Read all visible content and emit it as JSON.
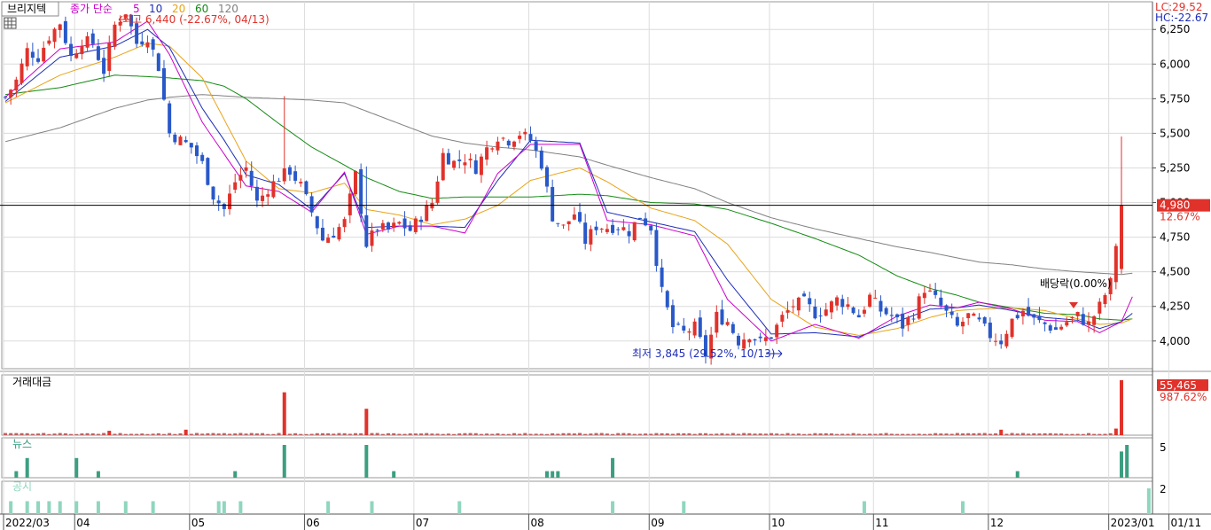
{
  "stock": {
    "name": "브리지텍",
    "legend_title": "종가 단순",
    "ma_labels": [
      "5",
      "10",
      "20",
      "60",
      "120"
    ],
    "ma_colors": [
      "#cc00cc",
      "#1d2db8",
      "#e8a317",
      "#138a13",
      "#808080"
    ]
  },
  "top_right": {
    "lc": "LC:29.52",
    "hc": "HC:-22.67"
  },
  "annotations": {
    "high": "최고 6,440 (-22.67%, 04/13)",
    "low": "최저 3,845 (29.52%, 10/13)",
    "dividend": "배당락(0.00%)"
  },
  "last_price": {
    "label": "4,980",
    "change": "12.67%",
    "value": 4980
  },
  "panels": {
    "amount": {
      "title": "거래대금",
      "last_label": "55,465",
      "last_change": "987.62%"
    },
    "news": {
      "title": "뉴스",
      "axis_label": "5"
    },
    "disclosure": {
      "title": "공시",
      "axis_label": "2"
    }
  },
  "chart_data": {
    "type": "candlestick",
    "ylim": [
      3800,
      6450
    ],
    "y_ticks": [
      4000,
      4250,
      4500,
      4750,
      5000,
      5250,
      5500,
      5750,
      6000,
      6250
    ],
    "y_tick_labels": [
      "4,000",
      "4,250",
      "4,500",
      "4,750",
      "5,000",
      "5,250",
      "5,500",
      "5,750",
      "6,000",
      "6,250"
    ],
    "x_tick_labels": [
      "2022/03",
      "04",
      "05",
      "06",
      "07",
      "08",
      "09",
      "10",
      "11",
      "12",
      "2023/01",
      "01/11"
    ],
    "x_tick_trading_days": [
      0,
      13,
      34,
      55,
      75,
      96,
      118,
      140,
      159,
      180,
      202,
      213
    ],
    "ma_series": [
      {
        "name": "5",
        "values": [
          [
            0,
            5760
          ],
          [
            10,
            6110
          ],
          [
            20,
            6160
          ],
          [
            26,
            6310
          ],
          [
            30,
            6070
          ],
          [
            36,
            5580
          ],
          [
            40,
            5350
          ],
          [
            44,
            5120
          ],
          [
            50,
            5080
          ],
          [
            56,
            4930
          ],
          [
            62,
            5220
          ],
          [
            66,
            4770
          ],
          [
            72,
            4830
          ],
          [
            78,
            4830
          ],
          [
            84,
            4780
          ],
          [
            90,
            5210
          ],
          [
            96,
            5420
          ],
          [
            105,
            5420
          ],
          [
            110,
            4870
          ],
          [
            118,
            4840
          ],
          [
            126,
            4760
          ],
          [
            132,
            4300
          ],
          [
            140,
            4000
          ],
          [
            148,
            4120
          ],
          [
            156,
            4020
          ],
          [
            163,
            4180
          ],
          [
            169,
            4260
          ],
          [
            174,
            4240
          ],
          [
            178,
            4280
          ],
          [
            184,
            4230
          ],
          [
            190,
            4150
          ],
          [
            196,
            4140
          ],
          [
            200,
            4060
          ],
          [
            204,
            4140
          ],
          [
            206,
            4320
          ]
        ]
      },
      {
        "name": "10",
        "values": [
          [
            0,
            5730
          ],
          [
            10,
            6050
          ],
          [
            20,
            6130
          ],
          [
            26,
            6250
          ],
          [
            30,
            6120
          ],
          [
            36,
            5680
          ],
          [
            40,
            5450
          ],
          [
            44,
            5200
          ],
          [
            50,
            5130
          ],
          [
            56,
            4950
          ],
          [
            62,
            5210
          ],
          [
            66,
            4820
          ],
          [
            72,
            4830
          ],
          [
            78,
            4830
          ],
          [
            84,
            4820
          ],
          [
            90,
            5160
          ],
          [
            96,
            5450
          ],
          [
            105,
            5430
          ],
          [
            110,
            4930
          ],
          [
            118,
            4860
          ],
          [
            126,
            4790
          ],
          [
            132,
            4440
          ],
          [
            140,
            4050
          ],
          [
            148,
            4060
          ],
          [
            156,
            4030
          ],
          [
            163,
            4140
          ],
          [
            169,
            4230
          ],
          [
            174,
            4240
          ],
          [
            178,
            4260
          ],
          [
            184,
            4220
          ],
          [
            190,
            4170
          ],
          [
            196,
            4150
          ],
          [
            200,
            4090
          ],
          [
            204,
            4140
          ],
          [
            206,
            4200
          ]
        ]
      },
      {
        "name": "20",
        "values": [
          [
            0,
            5720
          ],
          [
            10,
            5920
          ],
          [
            20,
            6050
          ],
          [
            26,
            6150
          ],
          [
            30,
            6130
          ],
          [
            36,
            5900
          ],
          [
            40,
            5600
          ],
          [
            44,
            5300
          ],
          [
            50,
            5100
          ],
          [
            56,
            5070
          ],
          [
            62,
            5140
          ],
          [
            66,
            4950
          ],
          [
            72,
            4910
          ],
          [
            78,
            4840
          ],
          [
            84,
            4880
          ],
          [
            90,
            4980
          ],
          [
            96,
            5160
          ],
          [
            105,
            5250
          ],
          [
            110,
            5150
          ],
          [
            118,
            4960
          ],
          [
            126,
            4870
          ],
          [
            132,
            4700
          ],
          [
            140,
            4300
          ],
          [
            148,
            4100
          ],
          [
            156,
            4040
          ],
          [
            163,
            4090
          ],
          [
            169,
            4170
          ],
          [
            174,
            4220
          ],
          [
            178,
            4230
          ],
          [
            184,
            4240
          ],
          [
            190,
            4220
          ],
          [
            196,
            4160
          ],
          [
            200,
            4120
          ],
          [
            204,
            4130
          ],
          [
            206,
            4160
          ]
        ]
      },
      {
        "name": "60",
        "values": [
          [
            0,
            5780
          ],
          [
            10,
            5830
          ],
          [
            20,
            5920
          ],
          [
            26,
            5910
          ],
          [
            30,
            5900
          ],
          [
            36,
            5880
          ],
          [
            40,
            5840
          ],
          [
            44,
            5750
          ],
          [
            50,
            5570
          ],
          [
            56,
            5400
          ],
          [
            62,
            5270
          ],
          [
            66,
            5180
          ],
          [
            72,
            5080
          ],
          [
            78,
            5030
          ],
          [
            84,
            5040
          ],
          [
            90,
            5040
          ],
          [
            96,
            5040
          ],
          [
            105,
            5060
          ],
          [
            110,
            5050
          ],
          [
            118,
            5000
          ],
          [
            126,
            4990
          ],
          [
            132,
            4950
          ],
          [
            140,
            4850
          ],
          [
            148,
            4740
          ],
          [
            156,
            4620
          ],
          [
            163,
            4470
          ],
          [
            169,
            4380
          ],
          [
            174,
            4330
          ],
          [
            178,
            4280
          ],
          [
            184,
            4240
          ],
          [
            190,
            4200
          ],
          [
            196,
            4190
          ],
          [
            200,
            4160
          ],
          [
            204,
            4150
          ],
          [
            206,
            4160
          ]
        ]
      },
      {
        "name": "120",
        "values": [
          [
            0,
            5440
          ],
          [
            10,
            5540
          ],
          [
            20,
            5680
          ],
          [
            26,
            5740
          ],
          [
            30,
            5760
          ],
          [
            36,
            5780
          ],
          [
            40,
            5770
          ],
          [
            44,
            5760
          ],
          [
            50,
            5750
          ],
          [
            56,
            5740
          ],
          [
            62,
            5720
          ],
          [
            66,
            5660
          ],
          [
            72,
            5570
          ],
          [
            78,
            5480
          ],
          [
            84,
            5430
          ],
          [
            90,
            5400
          ],
          [
            96,
            5380
          ],
          [
            105,
            5330
          ],
          [
            110,
            5270
          ],
          [
            118,
            5180
          ],
          [
            126,
            5100
          ],
          [
            132,
            5000
          ],
          [
            140,
            4890
          ],
          [
            148,
            4810
          ],
          [
            156,
            4740
          ],
          [
            163,
            4680
          ],
          [
            169,
            4640
          ],
          [
            174,
            4600
          ],
          [
            178,
            4570
          ],
          [
            184,
            4550
          ],
          [
            190,
            4520
          ],
          [
            196,
            4500
          ],
          [
            200,
            4490
          ],
          [
            204,
            4480
          ],
          [
            206,
            4490
          ]
        ]
      }
    ],
    "candle_path": [
      [
        0,
        5760
      ],
      [
        2,
        5880
      ],
      [
        4,
        6100
      ],
      [
        6,
        6050
      ],
      [
        8,
        6200
      ],
      [
        10,
        6300
      ],
      [
        12,
        6050
      ],
      [
        14,
        6170
      ],
      [
        16,
        6150
      ],
      [
        18,
        5950
      ],
      [
        20,
        6280
      ],
      [
        22,
        6380
      ],
      [
        24,
        6150
      ],
      [
        26,
        6200
      ],
      [
        28,
        5980
      ],
      [
        30,
        5500
      ],
      [
        32,
        5450
      ],
      [
        34,
        5400
      ],
      [
        36,
        5280
      ],
      [
        38,
        5050
      ],
      [
        40,
        4950
      ],
      [
        42,
        5150
      ],
      [
        44,
        5250
      ],
      [
        46,
        5000
      ],
      [
        48,
        5100
      ],
      [
        50,
        5180
      ],
      [
        52,
        5230
      ],
      [
        54,
        5120
      ],
      [
        56,
        4930
      ],
      [
        58,
        4730
      ],
      [
        60,
        4780
      ],
      [
        62,
        4860
      ],
      [
        64,
        5200
      ],
      [
        66,
        4700
      ],
      [
        68,
        4820
      ],
      [
        70,
        4800
      ],
      [
        72,
        4850
      ],
      [
        74,
        4800
      ],
      [
        76,
        4900
      ],
      [
        78,
        5000
      ],
      [
        80,
        5350
      ],
      [
        82,
        5290
      ],
      [
        84,
        5320
      ],
      [
        86,
        5250
      ],
      [
        88,
        5390
      ],
      [
        90,
        5480
      ],
      [
        92,
        5450
      ],
      [
        94,
        5500
      ],
      [
        96,
        5450
      ],
      [
        98,
        5280
      ],
      [
        100,
        4900
      ],
      [
        102,
        4820
      ],
      [
        104,
        4920
      ],
      [
        106,
        4720
      ],
      [
        108,
        4830
      ],
      [
        110,
        4820
      ],
      [
        112,
        4830
      ],
      [
        114,
        4790
      ],
      [
        116,
        4900
      ],
      [
        118,
        4820
      ],
      [
        120,
        4350
      ],
      [
        122,
        4100
      ],
      [
        124,
        4060
      ],
      [
        126,
        4100
      ],
      [
        128,
        3900
      ],
      [
        130,
        4180
      ],
      [
        132,
        4140
      ],
      [
        134,
        4000
      ],
      [
        136,
        4050
      ],
      [
        138,
        3990
      ],
      [
        140,
        4040
      ],
      [
        142,
        4170
      ],
      [
        144,
        4260
      ],
      [
        146,
        4280
      ],
      [
        148,
        4200
      ],
      [
        150,
        4230
      ],
      [
        152,
        4300
      ],
      [
        154,
        4260
      ],
      [
        156,
        4180
      ],
      [
        158,
        4320
      ],
      [
        160,
        4220
      ],
      [
        162,
        4180
      ],
      [
        164,
        4110
      ],
      [
        166,
        4200
      ],
      [
        168,
        4380
      ],
      [
        170,
        4300
      ],
      [
        172,
        4200
      ],
      [
        174,
        4100
      ],
      [
        176,
        4180
      ],
      [
        178,
        4130
      ],
      [
        180,
        4040
      ],
      [
        182,
        4000
      ],
      [
        184,
        4150
      ],
      [
        186,
        4220
      ],
      [
        188,
        4150
      ],
      [
        190,
        4120
      ],
      [
        192,
        4080
      ],
      [
        194,
        4140
      ],
      [
        196,
        4180
      ],
      [
        198,
        4120
      ],
      [
        200,
        4250
      ],
      [
        202,
        4420
      ],
      [
        204,
        4980
      ]
    ],
    "amount_spikes": [
      [
        19,
        0.08
      ],
      [
        33,
        0.1
      ],
      [
        51,
        0.78
      ],
      [
        66,
        0.48
      ],
      [
        182,
        0.1
      ],
      [
        203,
        0.12
      ],
      [
        204,
        1.0
      ]
    ],
    "news_counts": [
      [
        2,
        1
      ],
      [
        4,
        3
      ],
      [
        13,
        3
      ],
      [
        17,
        1
      ],
      [
        42,
        1
      ],
      [
        51,
        5
      ],
      [
        66,
        5
      ],
      [
        71,
        1
      ],
      [
        99,
        1
      ],
      [
        100,
        1
      ],
      [
        101,
        1
      ],
      [
        111,
        3
      ],
      [
        185,
        1
      ],
      [
        204,
        4
      ],
      [
        205,
        5
      ]
    ],
    "disclosure_counts": [
      [
        1,
        1
      ],
      [
        4,
        1
      ],
      [
        6,
        1
      ],
      [
        8,
        1
      ],
      [
        10,
        1
      ],
      [
        13,
        1
      ],
      [
        17,
        1
      ],
      [
        22,
        1
      ],
      [
        27,
        1
      ],
      [
        39,
        1
      ],
      [
        40,
        1
      ],
      [
        43,
        1
      ],
      [
        59,
        1
      ],
      [
        67,
        1
      ],
      [
        83,
        1
      ],
      [
        111,
        1
      ],
      [
        124,
        1
      ],
      [
        157,
        1
      ],
      [
        175,
        1
      ],
      [
        209,
        2
      ]
    ]
  }
}
